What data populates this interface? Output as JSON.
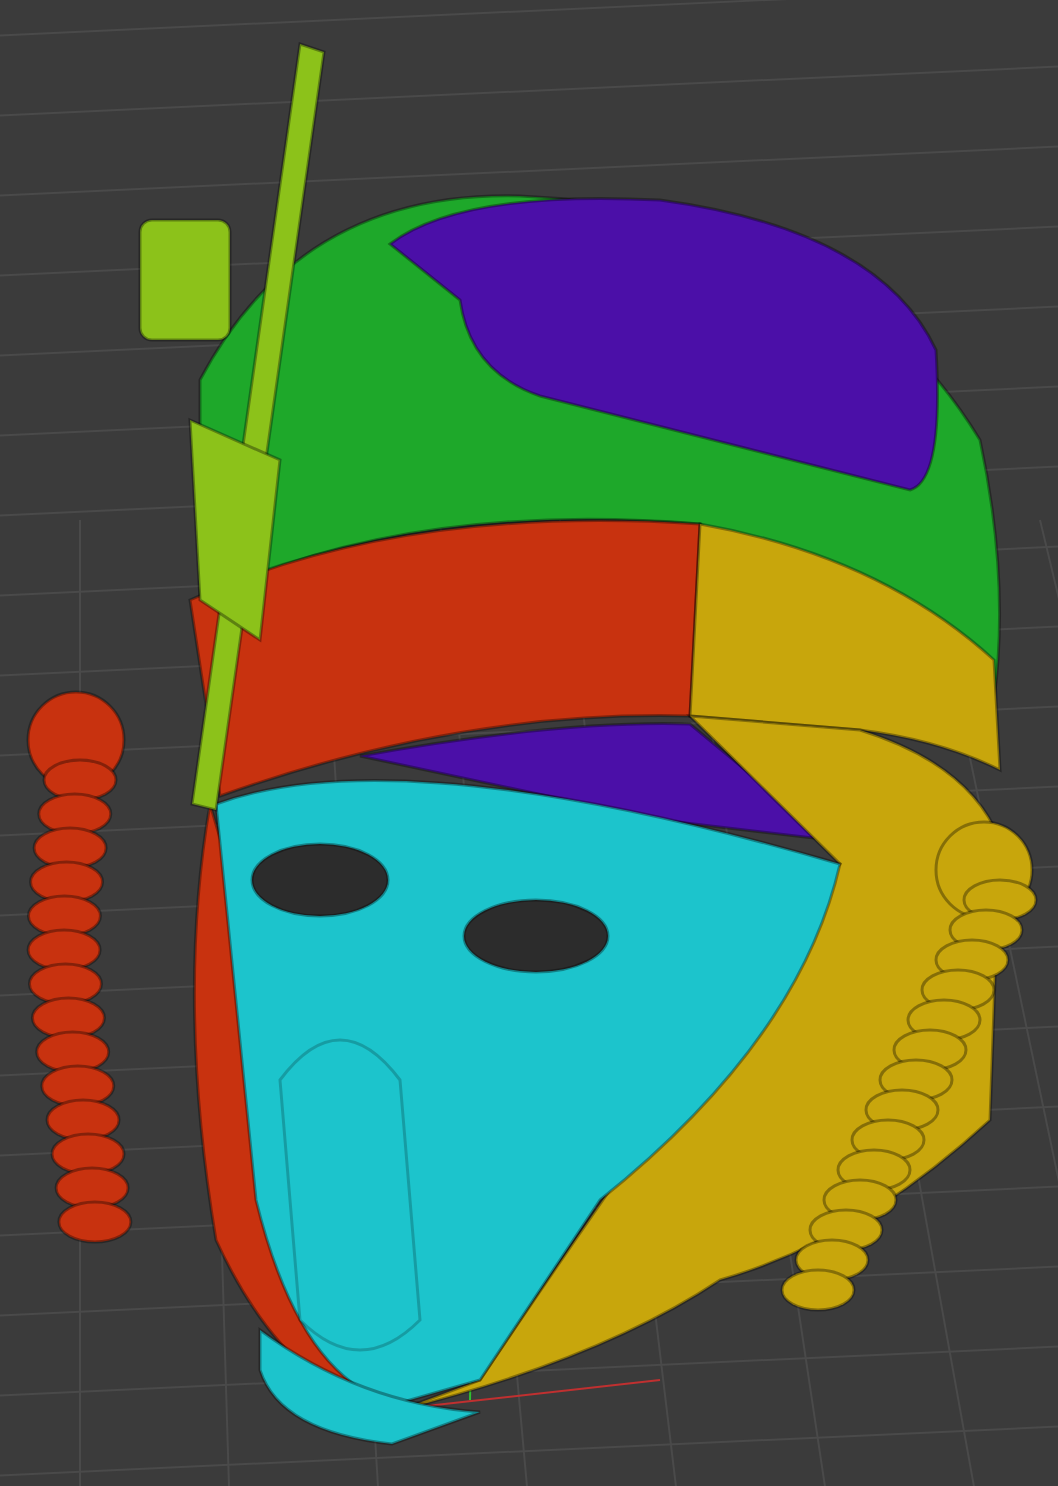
{
  "viewport": {
    "grid": true,
    "axes": true
  },
  "model": {
    "parts": [
      {
        "kind": "dome",
        "color": "#1ea82a"
      },
      {
        "kind": "crown",
        "color": "#4b0fa8"
      },
      {
        "kind": "band_left",
        "color": "#c8320f"
      },
      {
        "kind": "band_right",
        "color": "#c8a60c"
      },
      {
        "kind": "inner",
        "color": "#4b0fa8"
      },
      {
        "kind": "face_right",
        "color": "#c8a60c"
      },
      {
        "kind": "face_left",
        "color": "#c8320f"
      },
      {
        "kind": "mask",
        "color": "#1cc4cc"
      },
      {
        "kind": "hose_left",
        "color": "#c8320f"
      },
      {
        "kind": "hose_right",
        "color": "#c8a60c"
      },
      {
        "kind": "antenna",
        "color": "#8cc21a"
      }
    ]
  }
}
